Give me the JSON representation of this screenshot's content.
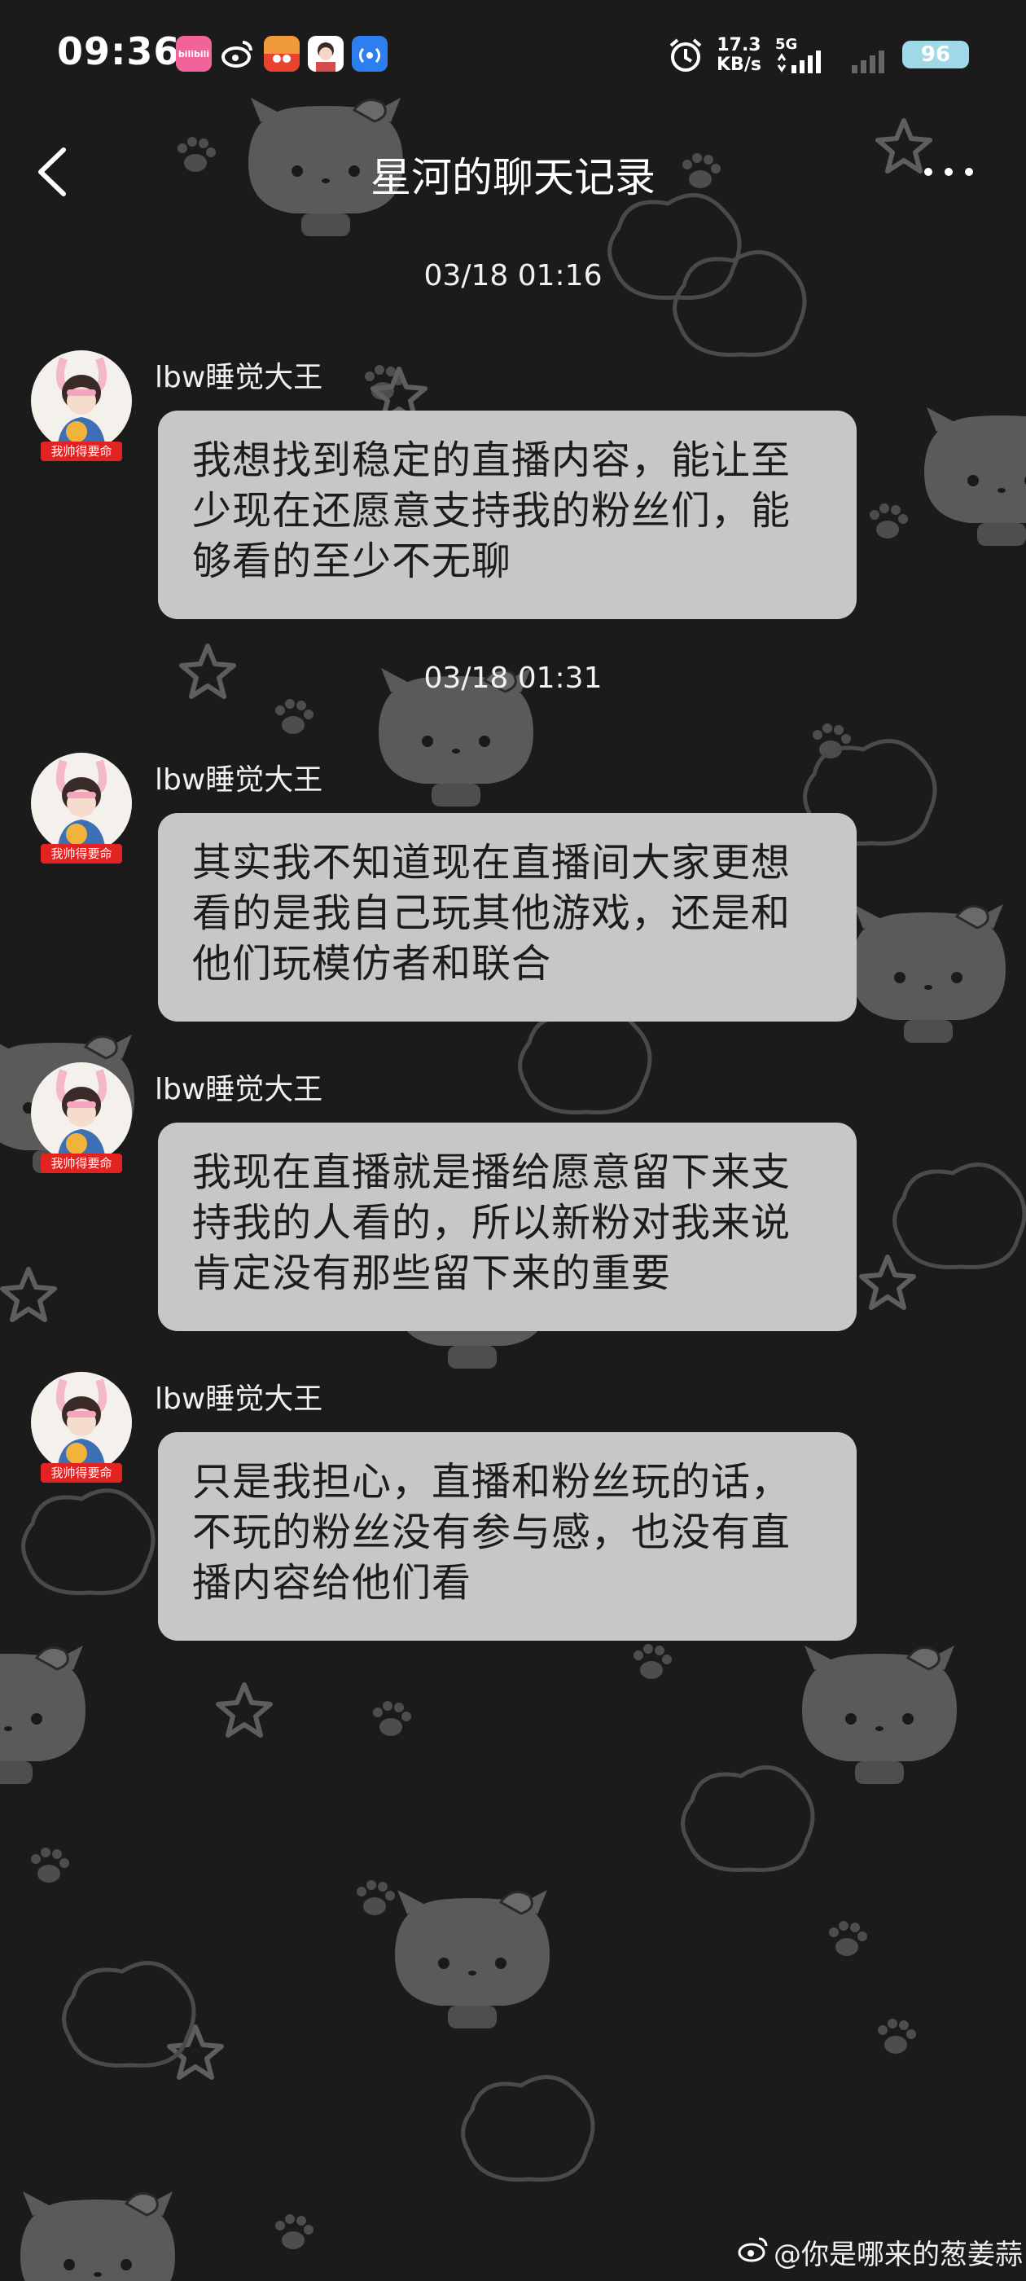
{
  "status_bar": {
    "time": "09:36",
    "net_speed": "17.3",
    "net_speed_unit": "KB/s",
    "network_type": "5G",
    "battery": "96",
    "app_icons": [
      "bilibili",
      "weibo",
      "app",
      "avatar",
      "signal"
    ],
    "bilibili_label": "bilibili"
  },
  "header": {
    "title": "星河的聊天记录"
  },
  "messages": [
    {
      "timestamp": "03/18 01:16",
      "sender": "lbw睡觉大王",
      "badge": "我帅得要命",
      "text": "我想找到稳定的直播内容，能让至少现在还愿意支持我的粉丝们，能够看的至少不无聊"
    },
    {
      "timestamp": "03/18 01:31",
      "sender": "lbw睡觉大王",
      "badge": "我帅得要命",
      "text": "其实我不知道现在直播间大家更想看的是我自己玩其他游戏，还是和他们玩模仿者和联合"
    },
    {
      "sender": "lbw睡觉大王",
      "badge": "我帅得要命",
      "text": "我现在直播就是播给愿意留下来支持我的人看的，所以新粉对我来说肯定没有那些留下来的重要"
    },
    {
      "sender": "lbw睡觉大王",
      "badge": "我帅得要命",
      "text": "只是我担心，直播和粉丝玩的话，不玩的粉丝没有参与感，也没有直播内容给他们看"
    }
  ],
  "watermark": "@你是哪来的葱姜蒜",
  "colors": {
    "background": "#1b1b1b",
    "bubble": "#c7c7c7",
    "badge": "#e32222",
    "battery": "#9fd8e6"
  }
}
